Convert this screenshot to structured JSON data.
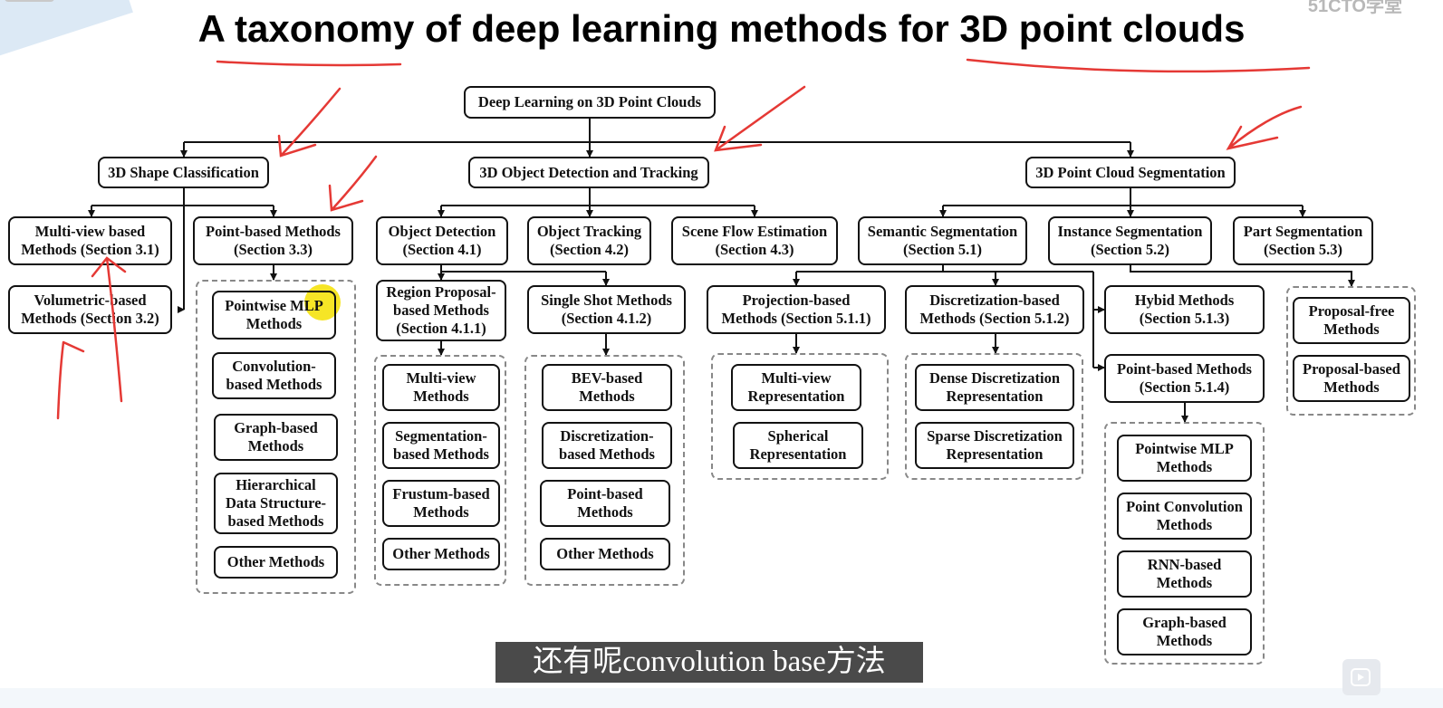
{
  "title": "A taxonomy of deep learning methods for 3D point clouds",
  "watermark": "51CTO学堂",
  "subtitle": "还有呢convolution base方法",
  "colors": {
    "annotation": "#e53935",
    "highlight": "#f5e000",
    "line": "#111111"
  },
  "diagram": {
    "root": "Deep Learning on 3D Point Clouds",
    "classification": {
      "title": "3D Shape Classification",
      "multiview": "Multi-view based\nMethods (Section 3.1)",
      "volumetric": "Volumetric-based\nMethods (Section 3.2)",
      "pointbased": "Point-based Methods\n(Section 3.3)",
      "point_methods": [
        "Pointwise MLP\nMethods",
        "Convolution-\nbased Methods",
        "Graph-based\nMethods",
        "Hierarchical\nData Structure-\nbased Methods",
        "Other Methods"
      ]
    },
    "detection": {
      "title": "3D Object Detection and Tracking",
      "object_detection": "Object Detection\n(Section 4.1)",
      "object_tracking": "Object Tracking\n(Section 4.2)",
      "scene_flow": "Scene Flow Estimation\n(Section 4.3)",
      "region_proposal": "Region Proposal-\nbased Methods\n(Section 4.1.1)",
      "single_shot": "Single Shot Methods\n(Section 4.1.2)",
      "region_methods": [
        "Multi-view\nMethods",
        "Segmentation-\nbased Methods",
        "Frustum-based\nMethods",
        "Other Methods"
      ],
      "single_methods": [
        "BEV-based\nMethods",
        "Discretization-\nbased Methods",
        "Point-based\nMethods",
        "Other Methods"
      ]
    },
    "segmentation": {
      "title": "3D Point Cloud Segmentation",
      "semantic": "Semantic Segmentation\n(Section 5.1)",
      "instance": "Instance Segmentation\n(Section 5.2)",
      "part": "Part Segmentation\n(Section 5.3)",
      "projection": "Projection-based\nMethods (Section 5.1.1)",
      "discretization": "Discretization-based\nMethods (Section 5.1.2)",
      "hybrid": "Hybid Methods\n(Section 5.1.3)",
      "pointbased": "Point-based Methods\n(Section 5.1.4)",
      "projection_methods": [
        "Multi-view\nRepresentation",
        "Spherical\nRepresentation"
      ],
      "discretization_methods": [
        "Dense Discretization\nRepresentation",
        "Sparse Discretization\nRepresentation"
      ],
      "point_methods": [
        "Pointwise MLP\nMethods",
        "Point Convolution\nMethods",
        "RNN-based\nMethods",
        "Graph-based\nMethods"
      ],
      "instance_methods": [
        "Proposal-free\nMethods",
        "Proposal-based\nMethods"
      ]
    }
  }
}
